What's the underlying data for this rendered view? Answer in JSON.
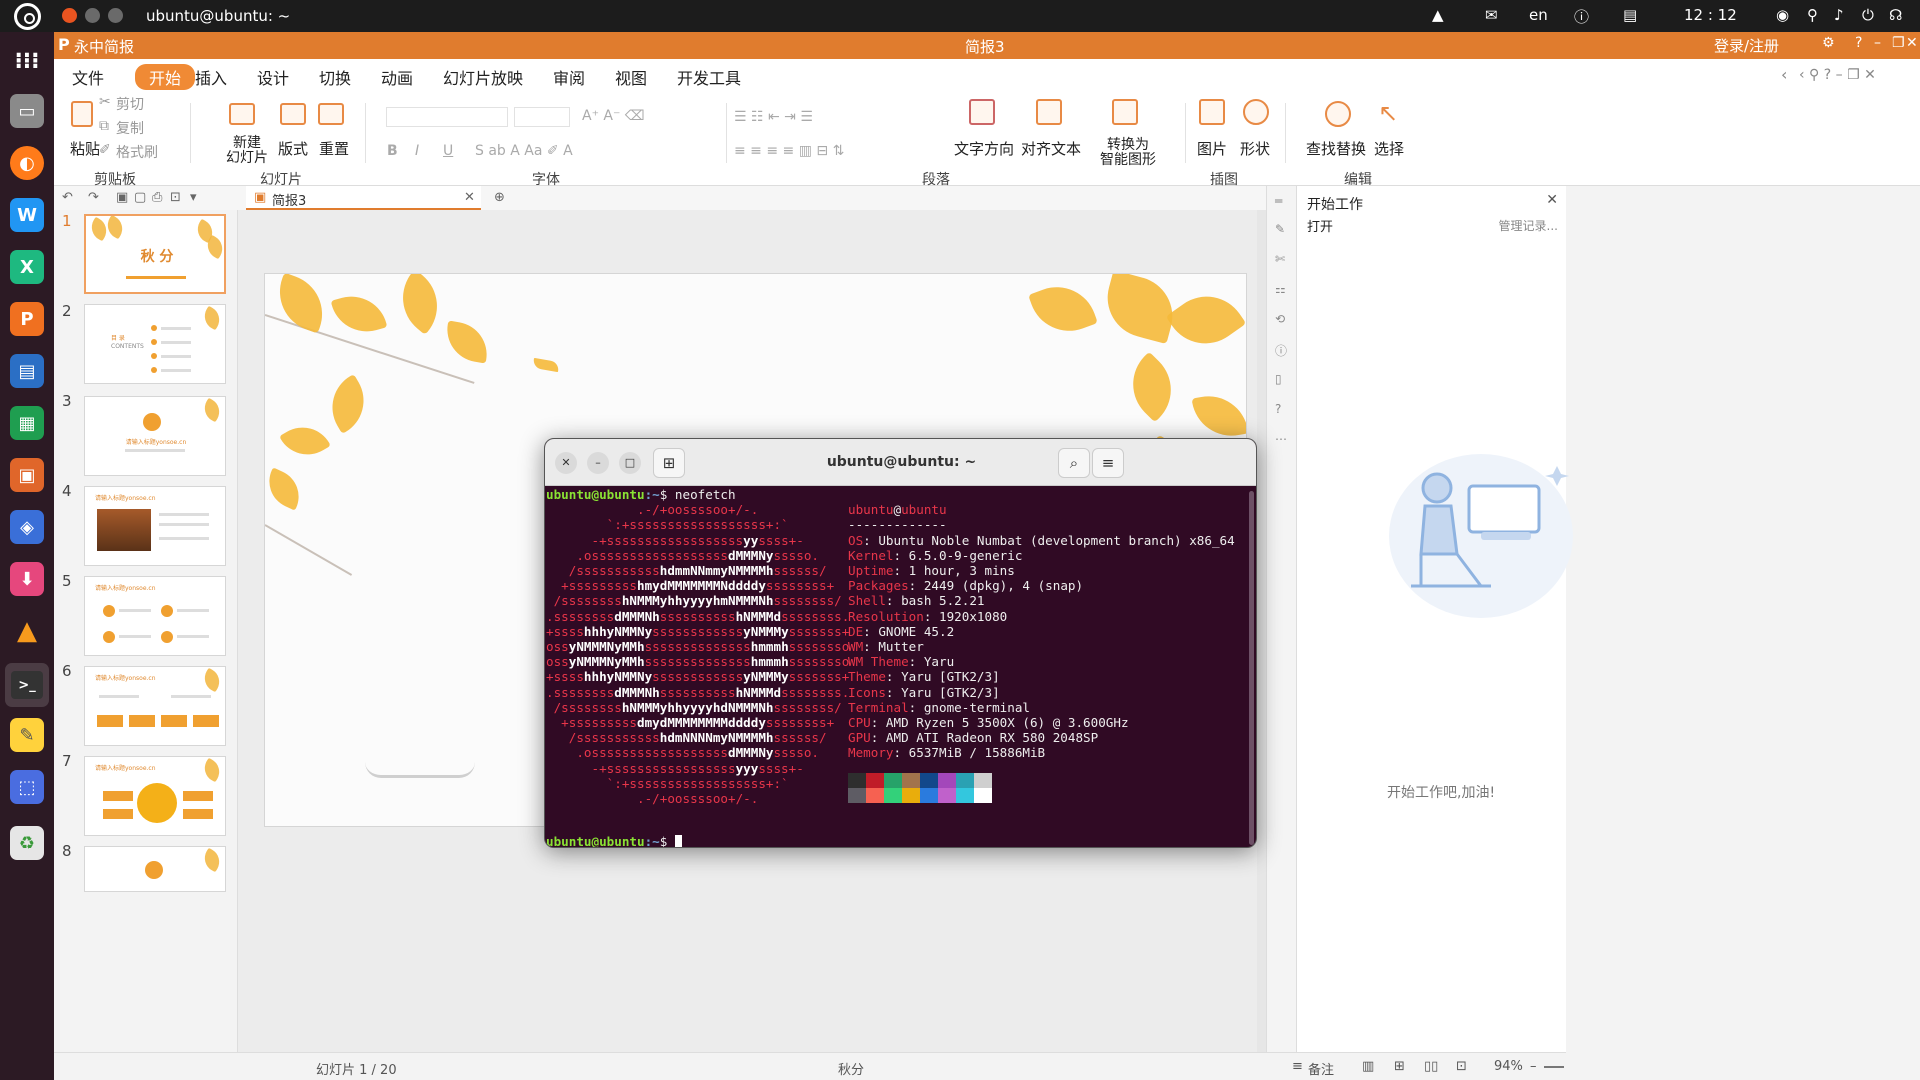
{
  "topbar": {
    "title": "ubuntu@ubuntu: ~",
    "lang": "en",
    "clock": "12 : 12"
  },
  "app": {
    "name": "永中简报",
    "document": "简报3",
    "login": "登录/注册"
  },
  "menu": [
    "文件",
    "开始",
    "插入",
    "设计",
    "切换",
    "动画",
    "幻灯片放映",
    "审阅",
    "视图",
    "开发工具"
  ],
  "ribbon": {
    "paste": "粘贴",
    "cut": "剪切",
    "copy": "复制",
    "format_painter": "格式刷",
    "new_slide": "新建\n幻灯片",
    "new_slide_l1": "新建",
    "new_slide_l2": "幻灯片",
    "layout": "版式",
    "reset": "重置",
    "text_direction": "文字方向",
    "align_text": "对齐文本",
    "smartart_l1": "转换为",
    "smartart_l2": "智能图形",
    "picture": "图片",
    "shape": "形状",
    "find_replace": "查找替换",
    "select": "选择",
    "groups": {
      "clipboard": "剪贴板",
      "slides": "幻灯片",
      "font": "字体",
      "paragraph": "段落",
      "illustrations": "插图",
      "editing": "编辑"
    }
  },
  "tab": {
    "doc_name": "简报3"
  },
  "slides": {
    "numbers": [
      "1",
      "2",
      "3",
      "4",
      "5",
      "6",
      "7",
      "8"
    ],
    "s1_title": "秋 分",
    "s2_title": "目 录",
    "s2_sub": "CONTENTS",
    "s3_title": "请输入标题yonsoe.cn",
    "s4_title": "请输入标题yonsoe.cn",
    "s5_title": "请输入标题yonsoe.cn",
    "s6_title": "请输入标题yonsoe.cn",
    "s7_title": "请输入标题yonsoe.cn"
  },
  "right_panel": {
    "header": "开始工作",
    "open": "打开",
    "manage": "管理记录...",
    "message": "开始工作吧,加油!"
  },
  "status": {
    "slide_info": "幻灯片 1 / 20",
    "theme": "秋分",
    "notes": "备注",
    "zoom": "94%"
  },
  "terminal": {
    "title": "ubuntu@ubuntu: ~",
    "prompt_user": "ubuntu@ubuntu",
    "prompt_path": ":~",
    "prompt_symbol": "$ ",
    "command": "neofetch",
    "user_host_user": "ubuntu",
    "user_host_at": "@",
    "user_host_host": "ubuntu",
    "separator": "-------------",
    "info": [
      {
        "k": "OS",
        "v": ": Ubuntu Noble Numbat (development branch) x86_64"
      },
      {
        "k": "Kernel",
        "v": ": 6.5.0-9-generic"
      },
      {
        "k": "Uptime",
        "v": ": 1 hour, 3 mins"
      },
      {
        "k": "Packages",
        "v": ": 2449 (dpkg), 4 (snap)"
      },
      {
        "k": "Shell",
        "v": ": bash 5.2.21"
      },
      {
        "k": "Resolution",
        "v": ": 1920x1080"
      },
      {
        "k": "DE",
        "v": ": GNOME 45.2"
      },
      {
        "k": "WM",
        "v": ": Mutter"
      },
      {
        "k": "WM Theme",
        "v": ": Yaru"
      },
      {
        "k": "Theme",
        "v": ": Yaru [GTK2/3]"
      },
      {
        "k": "Icons",
        "v": ": Yaru [GTK2/3]"
      },
      {
        "k": "Terminal",
        "v": ": gnome-terminal"
      },
      {
        "k": "CPU",
        "v": ": AMD Ryzen 5 3500X (6) @ 3.600GHz"
      },
      {
        "k": "GPU",
        "v": ": AMD ATI Radeon RX 580 2048SP"
      },
      {
        "k": "Memory",
        "v": ": 6537MiB / 15886MiB"
      }
    ],
    "ascii": [
      "            .-/+oossssoo+/-.",
      "        `:+ssssssssssssssssss+:`",
      "      -+ssssssssssssssssssyyssss+-",
      "    .ossssssssssssssssssdMMMNysssso.",
      "   /ssssssssssshdmmNNmmyNMMMMhssssss/",
      "  +ssssssssshmydMMMMMMMNddddyssssssss+",
      " /sssssssshNMMMyhhyyyyhmNMMMNhssssssss/",
      ".ssssssssdMMMNhsssssssssshNMMMdssssssss.",
      "+sssshhhyNMMNyssssssssssssyNMMMysssssss+",
      "ossyNMMMNyMMhsssssssssssssshmmmhssssssso",
      "ossyNMMMNyMMhsssssssssssssshmmmhssssssso",
      "+sssshhhyNMMNyssssssssssssyNMMMysssssss+",
      ".ssssssssdMMMNhsssssssssshNMMMdssssssss.",
      " /sssssssshNMMMyhhyyyyhdNMMMNhssssssss/",
      "  +sssssssssdmydMMMMMMMMddddyssssssss+",
      "   /ssssssssssshdmNNNNmyNMMMMhssssss/",
      "    .ossssssssssssssssssdMMMNysssso.",
      "      -+sssssssssssssssssyyyssss+-",
      "        `:+ssssssssssssssssss+:`",
      "            .-/+oossssoo+/-."
    ],
    "colors_top": [
      "#2e2e2e",
      "#c01c28",
      "#26a269",
      "#a2734c",
      "#12488b",
      "#a347ba",
      "#2aa1b3",
      "#cfcfcf"
    ],
    "colors_bottom": [
      "#5e5c64",
      "#f66151",
      "#33d17a",
      "#e9ad0c",
      "#2a7bde",
      "#c061cb",
      "#33c7de",
      "#ffffff"
    ]
  }
}
